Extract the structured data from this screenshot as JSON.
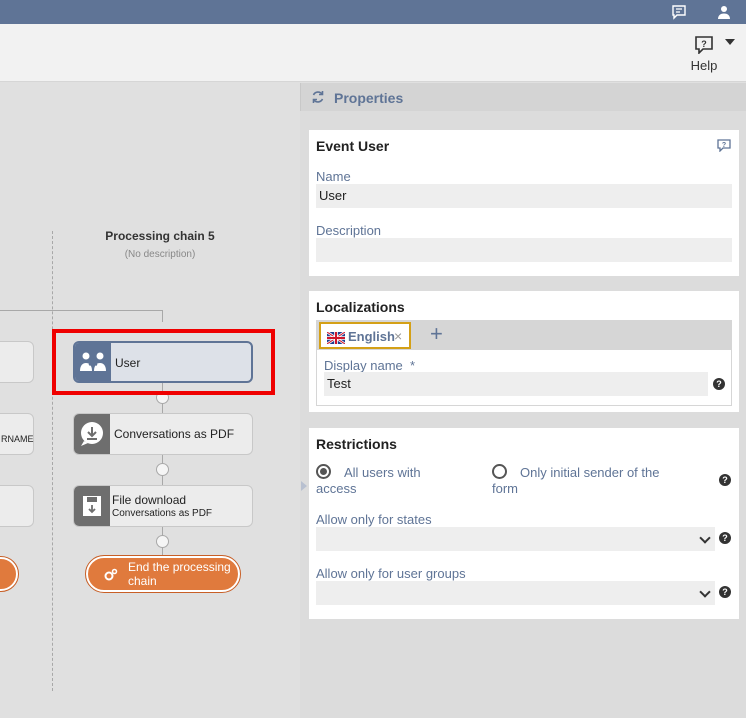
{
  "toolbar": {
    "help_label": "Help"
  },
  "canvas": {
    "chain_title": "Processing chain 5",
    "chain_description": "(No description)",
    "left_node_fragment": "RNAME",
    "nodes": {
      "user": "User",
      "conversations_pdf": "Conversations as PDF",
      "file_download": "File download",
      "file_download_sub": "Conversations as PDF",
      "end_chain": "End the processing chain"
    }
  },
  "properties": {
    "title": "Properties",
    "event": {
      "title": "Event User",
      "name_label": "Name",
      "name_value": "User",
      "description_label": "Description",
      "description_value": ""
    },
    "localizations": {
      "title": "Localizations",
      "tab_label": "English",
      "tab_close": "×",
      "add": "+",
      "display_name_label": "Display name  *",
      "display_name_value": "Test"
    },
    "restrictions": {
      "title": "Restrictions",
      "radio_all_line1": "All users with",
      "radio_all_line2": "access",
      "radio_initial_line1": "Only initial sender of the",
      "radio_initial_line2": "form",
      "states_label": "Allow only for states",
      "groups_label": "Allow only for user groups"
    }
  },
  "colors": {
    "accent": "#5f7496",
    "end_node": "#e07a3d",
    "highlight": "#ef0000"
  }
}
